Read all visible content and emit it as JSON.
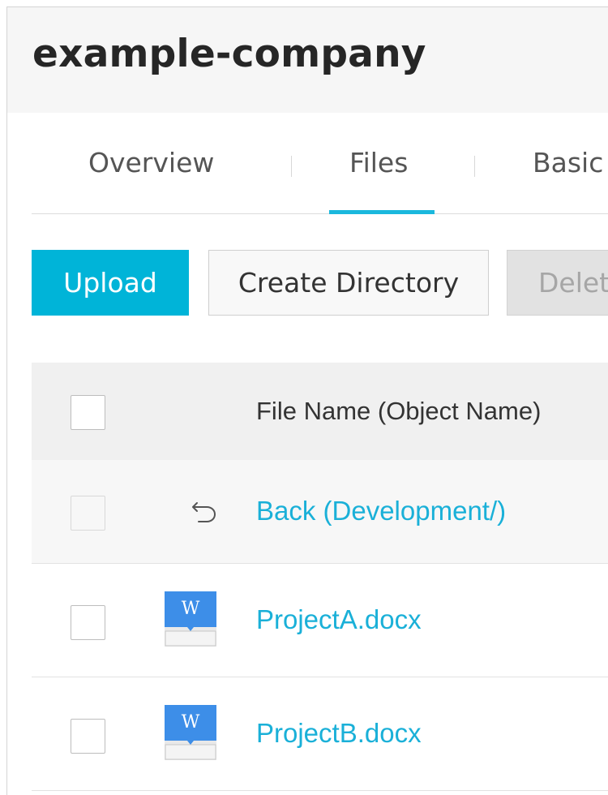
{
  "bucket": {
    "title": "example-company"
  },
  "tabs": [
    {
      "label": "Overview",
      "active": false
    },
    {
      "label": "Files",
      "active": true
    },
    {
      "label": "Basic",
      "active": false
    }
  ],
  "toolbar": {
    "upload_label": "Upload",
    "create_directory_label": "Create Directory",
    "delete_label": "Delet"
  },
  "table": {
    "header": {
      "file_name": "File Name (Object Name)"
    },
    "back_row": {
      "label": "Back (Development/)"
    },
    "files": [
      {
        "name": "ProjectA.docx",
        "icon": "word-doc-icon"
      },
      {
        "name": "ProjectB.docx",
        "icon": "word-doc-icon"
      }
    ]
  },
  "colors": {
    "accent": "#00b4d8",
    "link": "#1ab0d8",
    "tab_underline": "#1ab8dd",
    "word_icon": "#3d8ee8"
  }
}
